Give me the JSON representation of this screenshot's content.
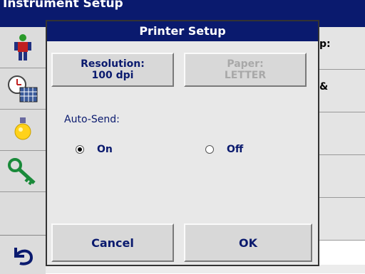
{
  "background": {
    "title": "Instrument Setup",
    "right_cells": [
      "p:",
      "&",
      "",
      "",
      ""
    ]
  },
  "sidebar": {
    "icons": [
      "operator-icon",
      "clock-calendar-icon",
      "lightbulb-icon",
      "key-icon"
    ],
    "back_icon": "back-arrow-icon"
  },
  "dialog": {
    "title": "Printer Setup",
    "resolution_label": "Resolution:",
    "resolution_value": "100 dpi",
    "paper_label": "Paper:",
    "paper_value": "LETTER",
    "auto_send_label": "Auto-Send:",
    "radio_on_label": "On",
    "radio_off_label": "Off",
    "auto_send_selected": "On",
    "cancel_label": "Cancel",
    "ok_label": "OK"
  },
  "colors": {
    "title_bar": "#0a1a6e",
    "dialog_bg": "#e8e8e8",
    "button_text": "#0a1a6e",
    "disabled_text": "#a8a8a8"
  }
}
